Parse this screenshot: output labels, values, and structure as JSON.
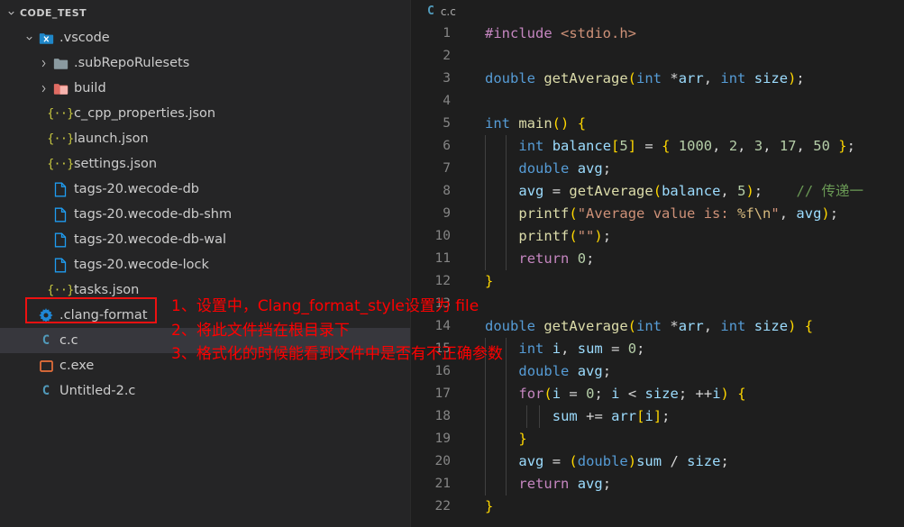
{
  "window": {
    "accent_red": "#ee1111",
    "sidebar_bg": "#252526",
    "editor_bg": "#1e1e1e",
    "selection_bg": "#37373d"
  },
  "explorer": {
    "header_label": "CODE_TEST",
    "header_twisty": "chevron-down-icon",
    "items": [
      {
        "label": ".vscode",
        "indent": 1,
        "twisty": "chevron-down",
        "icon": "folder-vscode",
        "selected": false
      },
      {
        "label": ".subRepoRulesets",
        "indent": 2,
        "twisty": "chevron-right",
        "icon": "folder-gray",
        "selected": false
      },
      {
        "label": "build",
        "indent": 2,
        "twisty": "chevron-right",
        "icon": "folder-red",
        "selected": false
      },
      {
        "label": "c_cpp_properties.json",
        "indent": 2,
        "twisty": "none",
        "icon": "json-icon",
        "selected": false
      },
      {
        "label": "launch.json",
        "indent": 2,
        "twisty": "none",
        "icon": "json-icon",
        "selected": false
      },
      {
        "label": "settings.json",
        "indent": 2,
        "twisty": "none",
        "icon": "json-icon",
        "selected": false
      },
      {
        "label": "tags-20.wecode-db",
        "indent": 2,
        "twisty": "none",
        "icon": "file-icon",
        "selected": false
      },
      {
        "label": "tags-20.wecode-db-shm",
        "indent": 2,
        "twisty": "none",
        "icon": "file-icon",
        "selected": false
      },
      {
        "label": "tags-20.wecode-db-wal",
        "indent": 2,
        "twisty": "none",
        "icon": "file-icon",
        "selected": false
      },
      {
        "label": "tags-20.wecode-lock",
        "indent": 2,
        "twisty": "none",
        "icon": "file-icon",
        "selected": false
      },
      {
        "label": "tasks.json",
        "indent": 2,
        "twisty": "none",
        "icon": "json-icon",
        "selected": false
      },
      {
        "label": ".clang-format",
        "indent": 1,
        "twisty": "none",
        "icon": "gear-icon",
        "selected": false
      },
      {
        "label": "c.c",
        "indent": 1,
        "twisty": "none",
        "icon": "c-file-icon",
        "selected": true
      },
      {
        "label": "c.exe",
        "indent": 1,
        "twisty": "none",
        "icon": "exe-icon",
        "selected": false
      },
      {
        "label": "Untitled-2.c",
        "indent": 1,
        "twisty": "none",
        "icon": "c-file-icon",
        "selected": false
      }
    ]
  },
  "breadcrumb": {
    "icon": "c-file-icon",
    "label": "c.c"
  },
  "annotation": {
    "color": "#ff0000",
    "lines": [
      "1、设置中，Clang_format_style设置为 file",
      "2、将此文件挡在根目录下",
      "3、格式化的时候能看到文件中是否有不正确参数"
    ]
  },
  "code": {
    "language": "c",
    "line_numbers": [
      1,
      2,
      3,
      4,
      5,
      6,
      7,
      8,
      9,
      10,
      11,
      12,
      13,
      14,
      15,
      16,
      17,
      18,
      19,
      20,
      21,
      22
    ],
    "lines": [
      "#include <stdio.h>",
      "",
      "double getAverage(int *arr, int size);",
      "",
      "int main() {",
      "    int balance[5] = { 1000, 2, 3, 17, 50 };",
      "    double avg;",
      "    avg = getAverage(balance, 5);    // 传递一",
      "    printf(\"Average value is: %f\\n\", avg);",
      "    printf(\"\");",
      "    return 0;",
      "}",
      "",
      "double getAverage(int *arr, int size) {",
      "    int i, sum = 0;",
      "    double avg;",
      "    for(i = 0; i < size; ++i) {",
      "        sum += arr[i];",
      "    }",
      "    avg = (double)sum / size;",
      "    return avg;",
      "}"
    ]
  }
}
